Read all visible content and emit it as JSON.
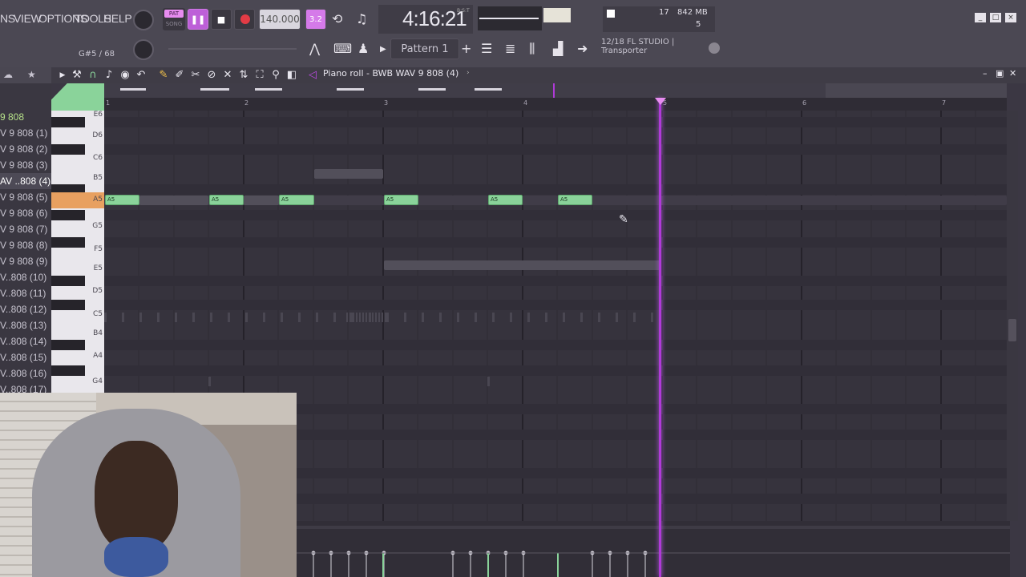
{
  "menu": [
    "NS",
    "VIEW",
    "OPTIONS",
    "TOOLS",
    "HELP"
  ],
  "transport": {
    "pat_label": "PAT",
    "song_label": "SONG",
    "tempo": "140.000",
    "time": "4:16:21",
    "time_sub": "B:S:T",
    "step_label": "3.2"
  },
  "status": {
    "cpu_value": "17",
    "memory": "842 MB",
    "poly": "5",
    "hint_counter": "G#5 / 68",
    "hint_line1": "12/18  FL STUDIO |",
    "hint_line2": "Transporter"
  },
  "pattern_selector": "Pattern 1",
  "piano_roll": {
    "title": "Piano roll - BWB WAV 9 808 (4)",
    "ruler_bars": [
      "1",
      "2",
      "3",
      "4",
      "5",
      "6",
      "7"
    ],
    "key_labels": [
      "E6",
      "D6",
      "C6",
      "B5",
      "A5",
      "G5",
      "F5",
      "E5",
      "D5",
      "C5",
      "B4",
      "A4",
      "G4"
    ],
    "note_label": "A5"
  },
  "channel_list": {
    "header": "9 808",
    "items": [
      "V 9 808 (1)",
      "V 9 808 (2)",
      "V 9 808 (3)",
      "AV ..808 (4)",
      "V 9 808 (5)",
      "V 9 808 (6)",
      "V 9 808 (7)",
      "V 9 808 (8)",
      "V 9 808 (9)",
      "V..808 (10)",
      "V..808 (11)",
      "V..808 (12)",
      "V..808 (13)",
      "V..808 (14)",
      "V..808 (15)",
      "V..808 (16)",
      "V..808 (17)"
    ]
  },
  "colors": {
    "accent": "#c04ae8",
    "note": "#8ad39a",
    "playhead": "#b03ad8",
    "selected_key": "#e8a060"
  },
  "icons": [
    "play-icon",
    "wrench-icon",
    "magnet-icon",
    "pencil-icon",
    "paint-icon",
    "delete-icon",
    "mute-icon",
    "slice-icon",
    "select-icon",
    "zoom-icon",
    "speaker-icon",
    "minimize-icon",
    "maximize-icon",
    "close-icon"
  ]
}
